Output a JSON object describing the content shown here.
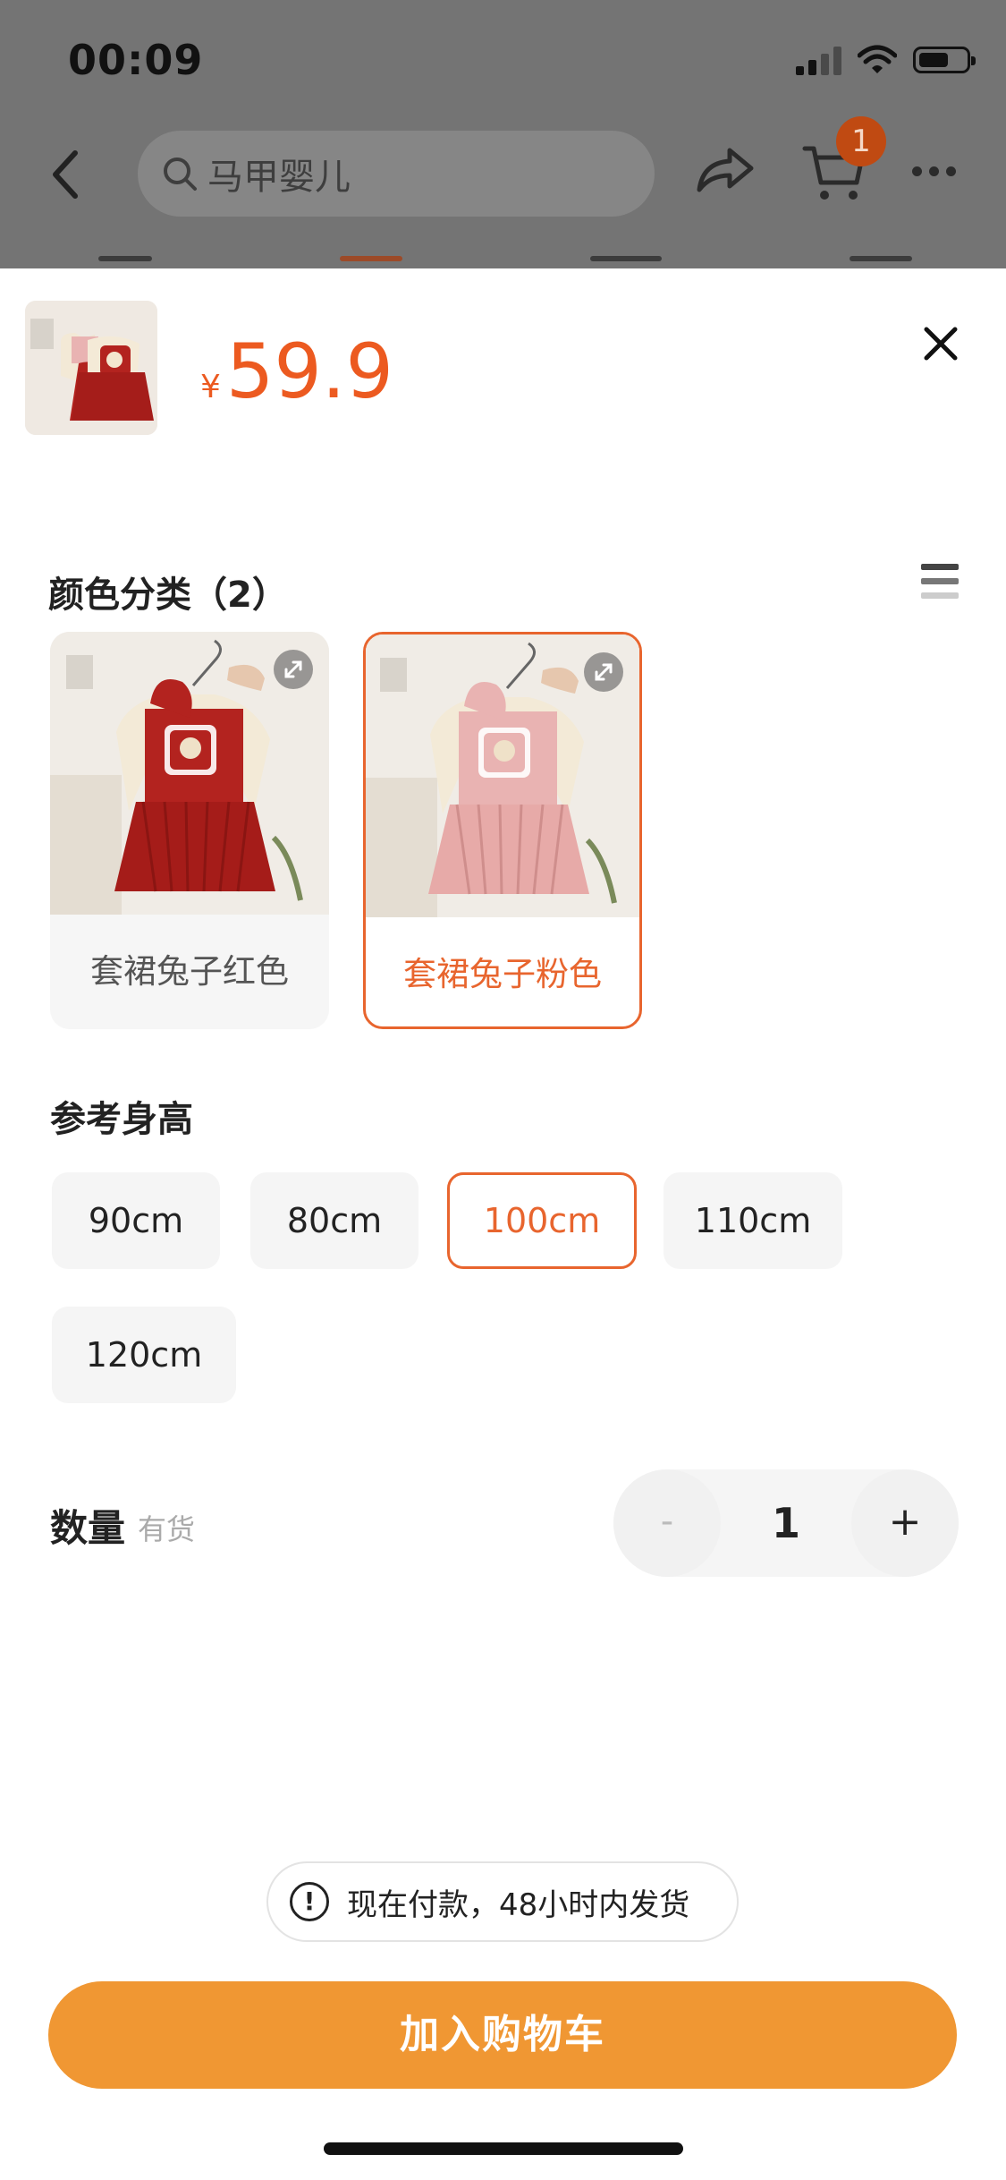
{
  "status_bar": {
    "time": "00:09"
  },
  "header": {
    "search_placeholder": "马甲婴儿",
    "cart_count": "1"
  },
  "sheet": {
    "currency": "¥",
    "price": "59.9",
    "color_section": {
      "title": "颜色分类（2）",
      "options": [
        {
          "label": "套裙兔子红色",
          "selected": false,
          "dress_color": "#b3231f"
        },
        {
          "label": "套裙兔子粉色",
          "selected": true,
          "dress_color": "#e9b3b2"
        }
      ]
    },
    "size_section": {
      "title": "参考身高",
      "options": [
        {
          "label": "90cm",
          "selected": false
        },
        {
          "label": "80cm",
          "selected": false
        },
        {
          "label": "100cm",
          "selected": true
        },
        {
          "label": "110cm",
          "selected": false
        },
        {
          "label": "120cm",
          "selected": false
        }
      ]
    },
    "quantity": {
      "label": "数量",
      "stock_status": "有货",
      "minus_label": "-",
      "value": "1",
      "plus_label": "+"
    },
    "notice": "现在付款，48小时内发货",
    "add_to_cart": "加入购物车"
  },
  "colors": {
    "accent": "#e8652e",
    "price": "#ec5a20",
    "cta": "#f09733"
  }
}
